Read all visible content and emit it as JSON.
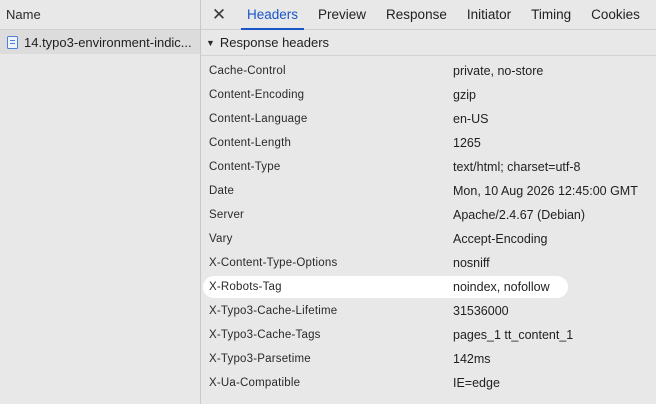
{
  "request_list": {
    "column_header": "Name",
    "selected_request": "14.typo3-environment-indic..."
  },
  "details": {
    "tabs": [
      {
        "label": "Headers",
        "active": true
      },
      {
        "label": "Preview",
        "active": false
      },
      {
        "label": "Response",
        "active": false
      },
      {
        "label": "Initiator",
        "active": false
      },
      {
        "label": "Timing",
        "active": false
      },
      {
        "label": "Cookies",
        "active": false
      }
    ],
    "section_title": "Response headers",
    "headers": [
      {
        "name": "Cache-Control",
        "value": "private, no-store"
      },
      {
        "name": "Content-Encoding",
        "value": "gzip"
      },
      {
        "name": "Content-Language",
        "value": "en-US"
      },
      {
        "name": "Content-Length",
        "value": "1265"
      },
      {
        "name": "Content-Type",
        "value": "text/html; charset=utf-8"
      },
      {
        "name": "Date",
        "value": "Mon, 10 Aug 2026 12:45:00 GMT"
      },
      {
        "name": "Server",
        "value": "Apache/2.4.67 (Debian)"
      },
      {
        "name": "Vary",
        "value": "Accept-Encoding"
      },
      {
        "name": "X-Content-Type-Options",
        "value": "nosniff"
      },
      {
        "name": "X-Robots-Tag",
        "value": "noindex, nofollow",
        "highlighted": true
      },
      {
        "name": "X-Typo3-Cache-Lifetime",
        "value": "31536000"
      },
      {
        "name": "X-Typo3-Cache-Tags",
        "value": "pages_1 tt_content_1"
      },
      {
        "name": "X-Typo3-Parsetime",
        "value": "142ms"
      },
      {
        "name": "X-Ua-Compatible",
        "value": "IE=edge"
      }
    ]
  },
  "colors": {
    "accent": "#1a55c9",
    "panel_bg": "#e8e8e8",
    "highlight_bg": "#ffffff"
  }
}
